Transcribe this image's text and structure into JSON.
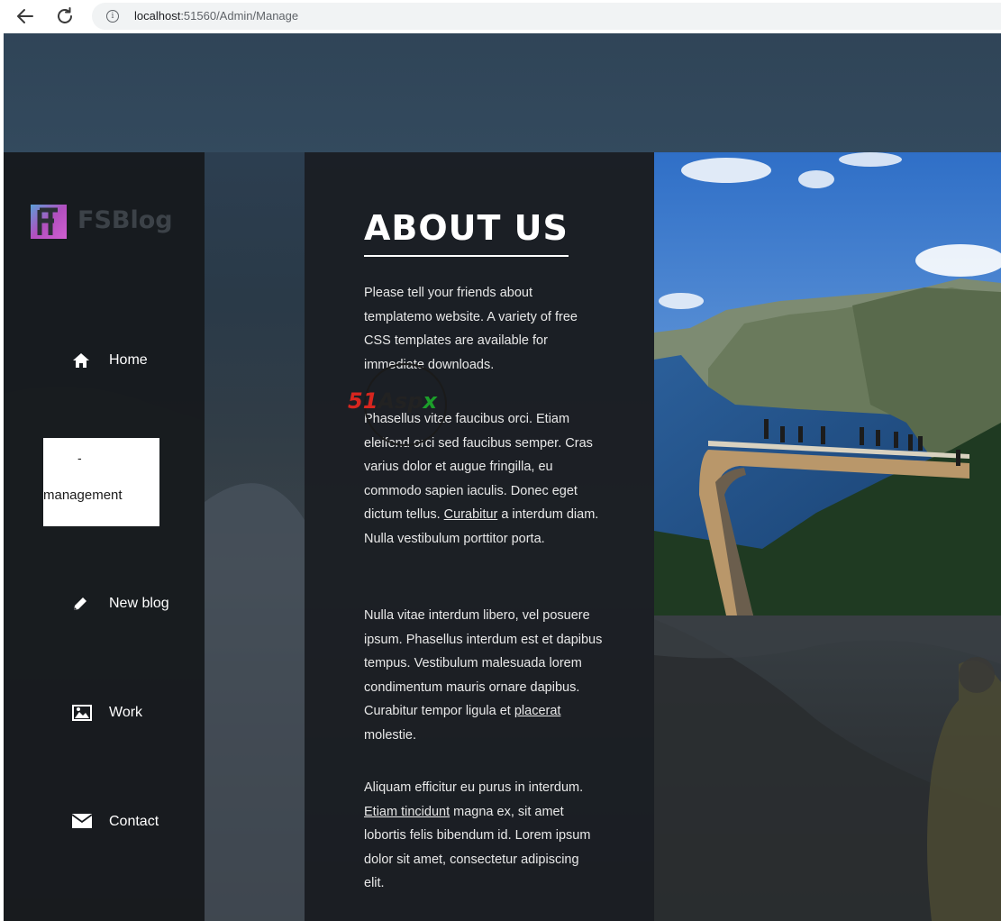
{
  "browser": {
    "back_icon": "arrow-left-icon",
    "reload_icon": "reload-icon",
    "info_icon": "info-icon",
    "url_host": "localhost",
    "url_path": ":51560/Admin/Manage"
  },
  "logo": {
    "text": "FSBlog"
  },
  "sidebar": {
    "items": [
      {
        "label": "Home",
        "icon": "home-icon"
      },
      {
        "label": "-",
        "sub_label": "management",
        "active": true
      },
      {
        "label": "New blog",
        "icon": "pencil-icon"
      },
      {
        "label": "Work",
        "icon": "image-icon"
      },
      {
        "label": "Contact",
        "icon": "envelope-icon"
      }
    ]
  },
  "about": {
    "title": "ABOUT US",
    "p1": "Please tell your friends about templatemo website. A variety of free CSS templates are available for immediate downloads.",
    "p2_a": "Phasellus vitae faucibus orci. Etiam eleifend orci sed faucibus semper. Cras varius dolor et augue fringilla, eu commodo sapien iaculis. Donec eget dictum tellus.",
    "p2_link": "Curabitur",
    "p2_b": "a interdum diam. Nulla vestibulum porttitor porta.",
    "p3_a": "Nulla vitae interdum libero, vel posuere ipsum. Phasellus interdum est et dapibus tempus. Vestibulum malesuada lorem condimentum mauris ornare dapibus. Curabitur tempor ligula et",
    "p3_link": "placerat",
    "p3_b": "molestie.",
    "p4_a": "Aliquam efficitur eu purus in interdum.",
    "p4_link": "Etiam tincidunt",
    "p4_b": "magna ex, sit amet lobortis felis bibendum id. Lorem ipsum dolor sit amet, consectetur adipiscing elit."
  },
  "watermark": {
    "num": "51",
    "word": "Asp",
    "last": "x"
  },
  "colors": {
    "sidebar_bg": "#16191d",
    "content_bg": "#1b1e23",
    "text": "#ffffff",
    "watermark_red": "#d7261f",
    "watermark_green": "#1c9e2a"
  }
}
